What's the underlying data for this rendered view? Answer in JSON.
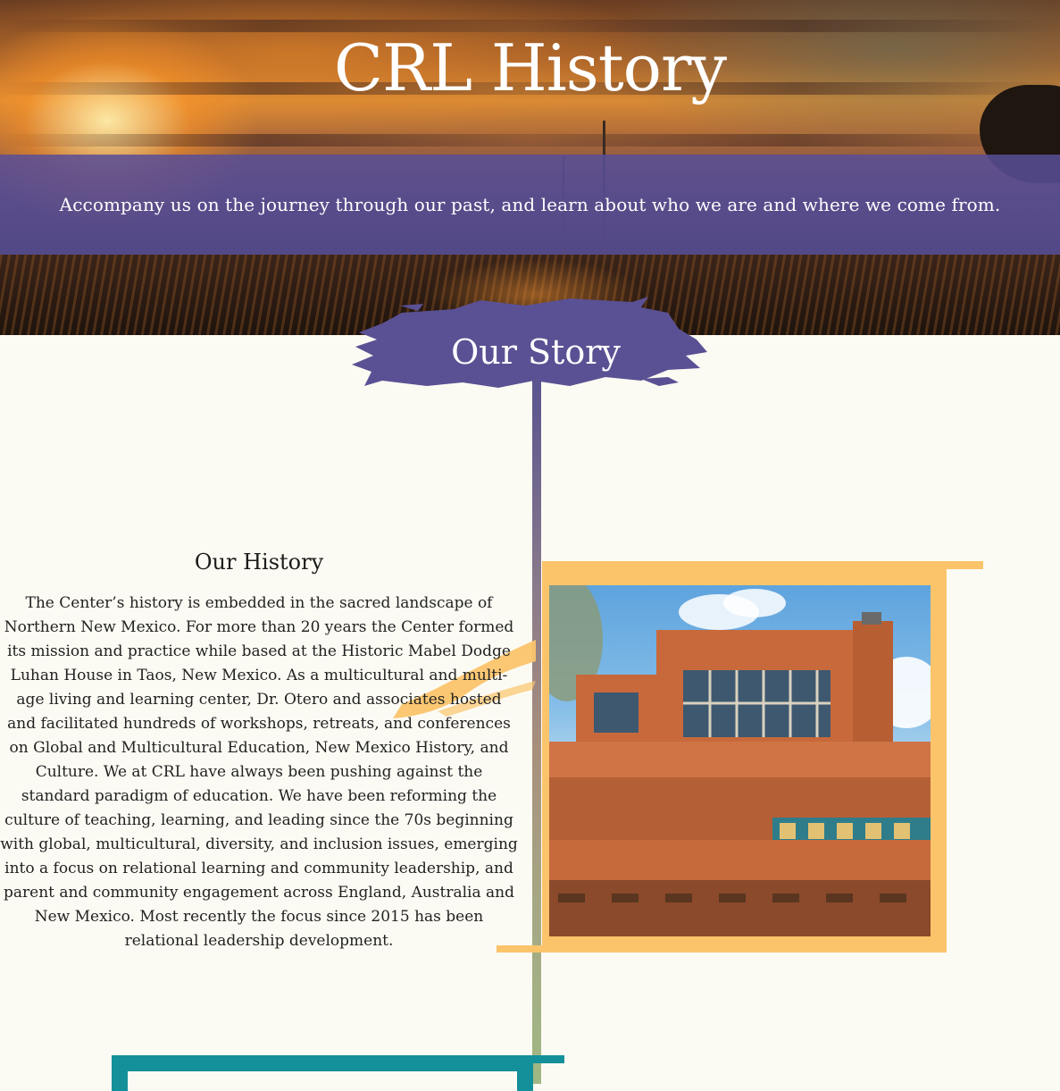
{
  "hero": {
    "title": "CRL History",
    "tagline": "Accompany us on the journey through our past, and learn about who we are and where we come from."
  },
  "story": {
    "title": "Our Story"
  },
  "history": {
    "heading": "Our History",
    "body": "The Center’s history is embedded in the sacred landscape of Northern New Mexico. For more than 20 years the Center formed its mission and practice while based at the Historic Mabel Dodge Luhan House in Taos, New Mexico. As a multicultural and multi-age living and learning center, Dr. Otero and associates hosted and facilitated hundreds of workshops, retreats, and conferences on Global and Multicultural Education, New Mexico History, and Culture. We at CRL have always been pushing against the standard paradigm of education. We have been reforming the culture of teaching, learning, and leading since the 70s beginning with global, multicultural, diversity, and inclusion issues, emerging into a focus on relational learning and community leadership, and parent and community engagement across England, Australia and New Mexico. Most recently the focus since 2015 has been relational leadership development."
  },
  "colors": {
    "brand_purple": "#584e96",
    "accent_orange": "#fbc46b",
    "accent_teal": "#13909a",
    "background": "#fcfbf3"
  }
}
